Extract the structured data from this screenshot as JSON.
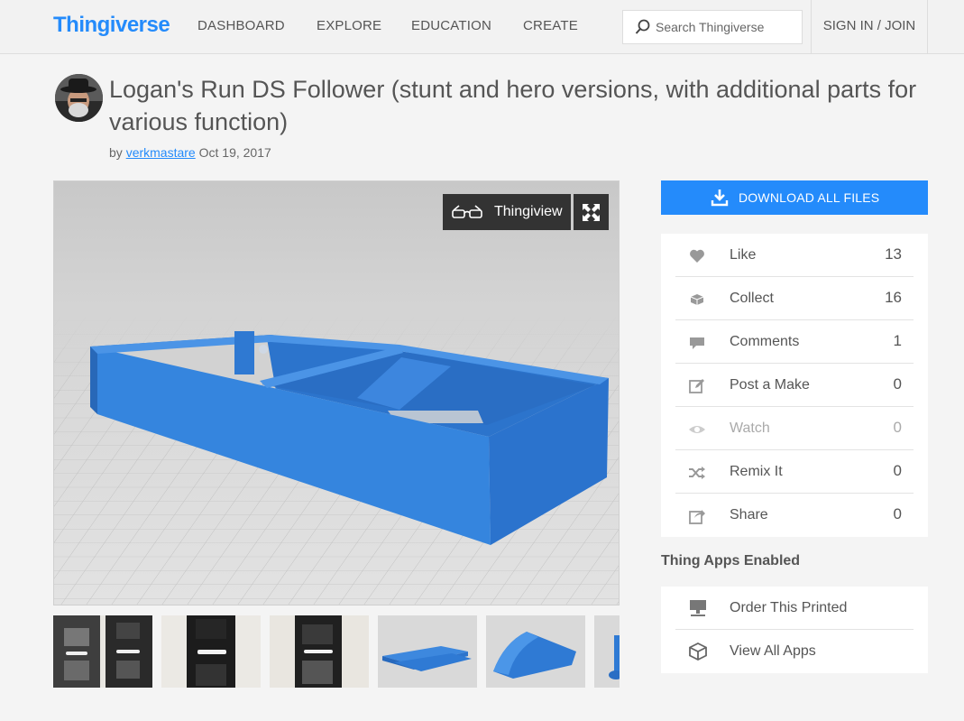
{
  "header": {
    "logo": "Thingiverse",
    "nav": [
      "DASHBOARD",
      "EXPLORE",
      "EDUCATION",
      "CREATE"
    ],
    "search_placeholder": "Search Thingiverse",
    "signin": "SIGN IN / JOIN"
  },
  "thing": {
    "title": "Logan's Run DS Follower (stunt and hero versions, with additional parts for various function)",
    "by": "by",
    "author": "verkmastare",
    "date": "Oct 19, 2017"
  },
  "viewer": {
    "thingview_label": "Thingiview",
    "thumbnail_count": 6
  },
  "actions": {
    "download_label": "DOWNLOAD ALL FILES",
    "stats": [
      {
        "label": "Like",
        "count": "13",
        "icon": "heart-icon"
      },
      {
        "label": "Collect",
        "count": "16",
        "icon": "collect-icon"
      },
      {
        "label": "Comments",
        "count": "1",
        "icon": "comment-icon"
      },
      {
        "label": "Post a Make",
        "count": "0",
        "icon": "edit-icon"
      },
      {
        "label": "Watch",
        "count": "0",
        "icon": "eye-icon"
      },
      {
        "label": "Remix It",
        "count": "0",
        "icon": "shuffle-icon"
      },
      {
        "label": "Share",
        "count": "0",
        "icon": "share-icon"
      }
    ]
  },
  "apps": {
    "heading": "Thing Apps Enabled",
    "items": [
      {
        "label": "Order This Printed",
        "icon": "printer-icon"
      },
      {
        "label": "View All Apps",
        "icon": "cube-icon"
      }
    ]
  },
  "colors": {
    "brand": "#248bfb",
    "model": "#2f7fd9",
    "text": "#555555"
  }
}
